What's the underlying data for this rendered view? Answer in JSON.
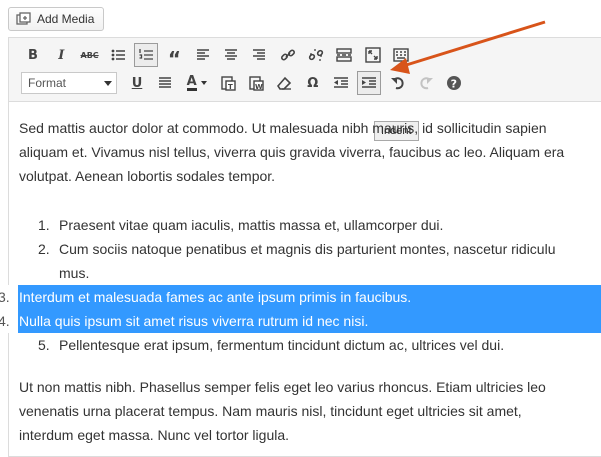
{
  "add_media": {
    "label": "Add Media"
  },
  "toolbar": {
    "row1": [
      {
        "name": "bold-button",
        "glyph": "B"
      },
      {
        "name": "italic-button",
        "glyph": "I"
      },
      {
        "name": "strikethrough-button",
        "glyph": "ABC"
      },
      {
        "name": "bulleted-list-button",
        "icon": "bulleted-list-icon"
      },
      {
        "name": "numbered-list-button",
        "icon": "numbered-list-icon",
        "active": true
      },
      {
        "name": "blockquote-button",
        "glyph": "“"
      },
      {
        "name": "align-left-button",
        "icon": "align-left-icon"
      },
      {
        "name": "align-center-button",
        "icon": "align-center-icon"
      },
      {
        "name": "align-right-button",
        "icon": "align-right-icon"
      },
      {
        "name": "insert-link-button",
        "icon": "link-icon"
      },
      {
        "name": "remove-link-button",
        "icon": "unlink-icon"
      },
      {
        "name": "read-more-button",
        "icon": "read-more-icon"
      },
      {
        "name": "fullscreen-button",
        "icon": "fullscreen-icon"
      },
      {
        "name": "toolbar-toggle-button",
        "icon": "keyboard-icon"
      }
    ],
    "format_select": {
      "value": "Format"
    },
    "row2": [
      {
        "name": "underline-button",
        "glyph": "U"
      },
      {
        "name": "justify-button",
        "icon": "justify-icon"
      },
      {
        "name": "text-color-button",
        "glyph": "A"
      },
      {
        "name": "paste-as-text-button",
        "icon": "paste-text-icon"
      },
      {
        "name": "paste-from-word-button",
        "icon": "paste-word-icon"
      },
      {
        "name": "clear-formatting-button",
        "icon": "eraser-icon"
      },
      {
        "name": "special-character-button",
        "glyph": "Ω"
      },
      {
        "name": "outdent-button",
        "icon": "outdent-icon"
      },
      {
        "name": "indent-button",
        "icon": "indent-icon",
        "active": true
      },
      {
        "name": "undo-button",
        "icon": "undo-icon"
      },
      {
        "name": "redo-button",
        "icon": "redo-icon",
        "dim": true
      },
      {
        "name": "help-button",
        "icon": "help-icon"
      }
    ],
    "tooltip": "Indent"
  },
  "content": {
    "paragraph1": [
      "Sed mattis auctor dolor at commodo. Ut malesuada nibh mauris, id sollicitudin sapien",
      "aliquam et. Vivamus nisl tellus, viverra quis gravida viverra, faucibus ac leo. Aliquam era",
      "volutpat. Aenean lobortis sodales tempor."
    ],
    "list": [
      {
        "num": "1.",
        "lines": [
          "Praesent vitae quam iaculis, mattis massa et, ullamcorper dui."
        ]
      },
      {
        "num": "2.",
        "lines": [
          "Cum sociis natoque penatibus et magnis dis parturient montes, nascetur ridiculu",
          "mus."
        ]
      },
      {
        "num": "3.",
        "lines": [
          "Interdum et malesuada fames ac ante ipsum primis in faucibus."
        ],
        "selected": true
      },
      {
        "num": "4.",
        "lines": [
          "Nulla quis ipsum sit amet risus viverra rutrum id nec nisi."
        ],
        "selected": true
      },
      {
        "num": "5.",
        "lines": [
          "Pellentesque erat ipsum, fermentum tincidunt dictum ac, ultrices vel dui."
        ]
      }
    ],
    "paragraph2": [
      "Ut non mattis nibh. Phasellus semper felis eget leo varius rhoncus. Etiam ultricies leo",
      "venenatis urna placerat tempus. Nam mauris nisl, tincidunt eget ultricies sit amet,",
      "interdum eget massa. Nunc vel tortor ligula."
    ]
  },
  "colors": {
    "selection": "#3399ff",
    "arrow": "#d8541a",
    "toolbar_bg": "#f5f5f5"
  }
}
